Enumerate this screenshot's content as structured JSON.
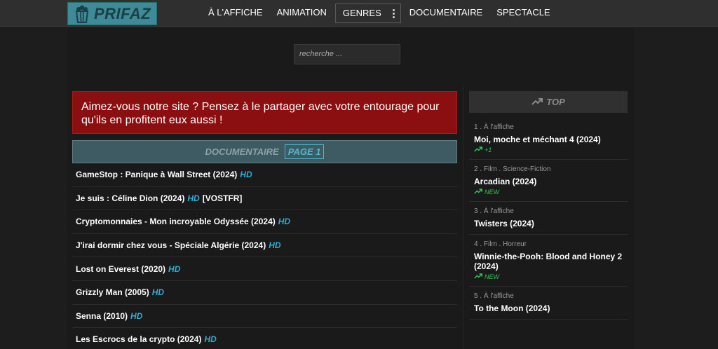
{
  "brand": {
    "name": "PRIFAZ",
    "icon": "popcorn-icon"
  },
  "nav": {
    "items": [
      "À L'AFFICHE",
      "ANIMATION",
      "GENRES",
      "DOCUMENTAIRE",
      "SPECTACLE"
    ]
  },
  "search": {
    "placeholder": "recherche ..."
  },
  "banner": {
    "text": "Aimez-vous notre site ? Pensez à le partager avec votre entourage pour qu'ils en profitent eux aussi !"
  },
  "section": {
    "title": "DOCUMENTAIRE",
    "page": "PAGE 1"
  },
  "films": [
    {
      "title": "GameStop : Panique à Wall Street (2024)",
      "quality": "HD",
      "extra": ""
    },
    {
      "title": "Je suis : Céline Dion (2024)",
      "quality": "HD",
      "extra": "[VOSTFR]"
    },
    {
      "title": "Cryptomonnaies - Mon incroyable Odyssée (2024)",
      "quality": "HD",
      "extra": ""
    },
    {
      "title": "J'irai dormir chez vous - Spéciale Algérie (2024)",
      "quality": "HD",
      "extra": ""
    },
    {
      "title": "Lost on Everest (2020)",
      "quality": "HD",
      "extra": ""
    },
    {
      "title": "Grizzly Man (2005)",
      "quality": "HD",
      "extra": ""
    },
    {
      "title": "Senna (2010)",
      "quality": "HD",
      "extra": ""
    },
    {
      "title": "Les Escrocs de la crypto (2024)",
      "quality": "HD",
      "extra": ""
    }
  ],
  "top": {
    "title": "TOP",
    "items": [
      {
        "meta": "1 . À l'affiche",
        "title": "Moi, moche et méchant 4 (2024)",
        "trend": "+1"
      },
      {
        "meta": "2 . Film . Science-Fiction",
        "title": "Arcadian (2024)",
        "trend": "NEW"
      },
      {
        "meta": "3 . À l'affiche",
        "title": "Twisters (2024)",
        "trend": ""
      },
      {
        "meta": "4 . Film . Horreur",
        "title": "Winnie-the-Pooh: Blood and Honey 2 (2024)",
        "trend": "NEW"
      },
      {
        "meta": "5 . À l'affiche",
        "title": "To the Moon (2024)",
        "trend": ""
      }
    ]
  },
  "colors": {
    "accent": "#2ab0d6",
    "banner": "#8b0f10",
    "trend": "#2fc455",
    "logo_bg": "#3e8a96"
  }
}
